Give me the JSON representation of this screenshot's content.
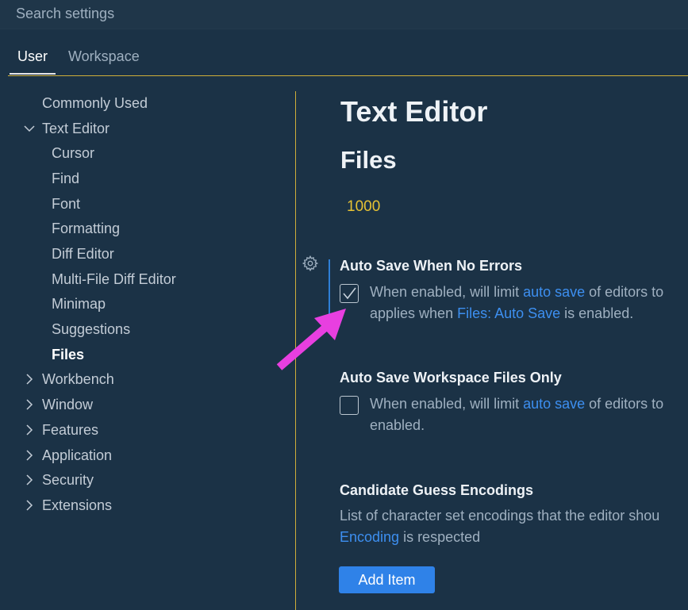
{
  "search": {
    "placeholder": "Search settings"
  },
  "tabs": [
    {
      "label": "User"
    },
    {
      "label": "Workspace"
    }
  ],
  "toc": {
    "items": [
      {
        "label": "Commonly Used"
      },
      {
        "label": "Text Editor"
      },
      {
        "label": "Cursor"
      },
      {
        "label": "Find"
      },
      {
        "label": "Font"
      },
      {
        "label": "Formatting"
      },
      {
        "label": "Diff Editor"
      },
      {
        "label": "Multi-File Diff Editor"
      },
      {
        "label": "Minimap"
      },
      {
        "label": "Suggestions"
      },
      {
        "label": "Files"
      },
      {
        "label": "Workbench"
      },
      {
        "label": "Window"
      },
      {
        "label": "Features"
      },
      {
        "label": "Application"
      },
      {
        "label": "Security"
      },
      {
        "label": "Extensions"
      }
    ]
  },
  "main": {
    "heading": "Text Editor",
    "subheading": "Files",
    "prev_value": "1000",
    "settings": [
      {
        "title": "Auto Save When No Errors",
        "checked": true,
        "line1_pre": "When enabled, will limit ",
        "line1_link": "auto save",
        "line1_post": " of editors to",
        "line2_pre": "applies when ",
        "line2_link": "Files: Auto Save",
        "line2_post": " is enabled."
      },
      {
        "title": "Auto Save Workspace Files Only",
        "checked": false,
        "line1_pre": "When enabled, will limit ",
        "line1_link": "auto save",
        "line1_post": " of editors to",
        "line2": "enabled."
      },
      {
        "title": "Candidate Guess Encodings",
        "line1": "List of character set encodings that the editor shou",
        "line2_link": "Encoding",
        "line2_post": " is respected",
        "button": "Add Item"
      }
    ]
  },
  "colors": {
    "background": "#1b3246",
    "accent_border": "#cfae39",
    "link": "#3d8ff0",
    "button": "#2f82e8",
    "value_highlight": "#e6c234",
    "annotation_arrow": "#e83fe0"
  }
}
